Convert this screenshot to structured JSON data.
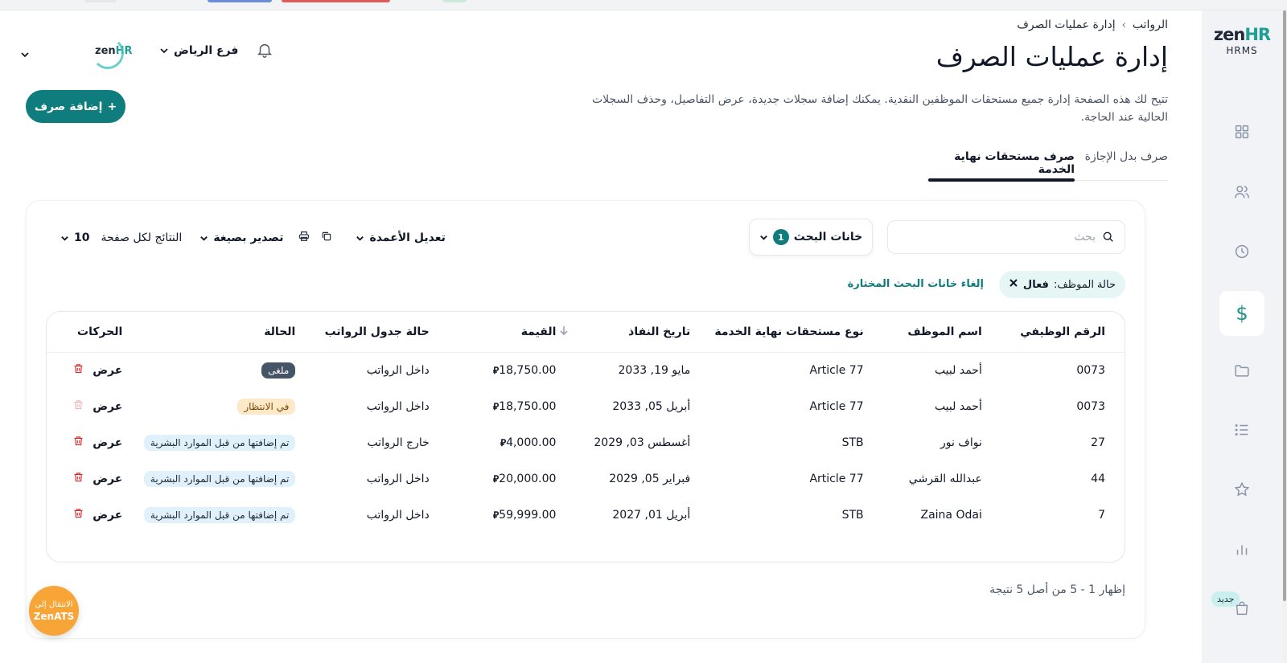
{
  "brand": {
    "logo_zen": "zen",
    "logo_hr": "HR",
    "sub": "HRMS"
  },
  "sidebar": {
    "items": [
      {
        "icon": "dashboard-grid-icon"
      },
      {
        "icon": "users-icon"
      },
      {
        "icon": "clock-icon"
      },
      {
        "icon": "dollar-icon",
        "label": "$",
        "active": true
      },
      {
        "icon": "folder-icon"
      },
      {
        "icon": "list-icon"
      },
      {
        "icon": "star-icon"
      },
      {
        "icon": "bar-chart-icon"
      },
      {
        "icon": "shopping-bag-icon"
      }
    ],
    "new_badge": "جديد"
  },
  "header": {
    "branch": "فرع الرياض",
    "company_logo_zen": "zen",
    "company_logo_hr": "HR"
  },
  "breadcrumb": {
    "parent": "الرواتب",
    "separator": "›",
    "current": "إدارة عمليات الصرف"
  },
  "page": {
    "title": "إدارة عمليات الصرف",
    "description": "تتيح لك هذه الصفحة إدارة جميع مستحقات الموظفين النقدية. يمكنك إضافة سجلات جديدة، عرض التفاصيل، وحذف السجلات الحالية عند الحاجة.",
    "add_button": "إضافة صرف",
    "add_button_icon": "+"
  },
  "tabs": [
    {
      "label": "صرف بدل الإجازة",
      "active": false
    },
    {
      "label": "صرف مستحقات نهاية الخدمة",
      "active": true
    }
  ],
  "search": {
    "placeholder": "بحث",
    "value": ""
  },
  "filter": {
    "label": "خانات البحث",
    "count": "1"
  },
  "toolbar": {
    "columns_label": "تعديل الأعمدة",
    "export_label": "تصدير بصيغة",
    "per_page_label": "النتائج لكل صفحة",
    "per_page_value": "10"
  },
  "active_filter": {
    "key": "حالة الموظف:",
    "value": "فعال"
  },
  "clear_filters": "إلغاء خانات البحث المختارة",
  "table": {
    "headers": {
      "id": "الرقم الوظيفي",
      "name": "اسم الموظف",
      "type": "نوع مستحقات نهاية الخدمة",
      "date": "تاريخ النفاذ",
      "amount": "القيمة",
      "payroll": "حالة جدول الرواتب",
      "status": "الحالة",
      "actions": "الحركات"
    },
    "currency_symbol": "⃁",
    "view_label": "عرض",
    "rows": [
      {
        "id": "0073",
        "name": "أحمد لبيب",
        "type": "Article 77",
        "date": "مايو 19, 2033",
        "amount": "18,750.00",
        "payroll": "داخل الرواتب",
        "status": "ملغى",
        "status_kind": "closed",
        "delete_enabled": true
      },
      {
        "id": "0073",
        "name": "أحمد لبيب",
        "type": "Article 77",
        "date": "أبريل 05, 2033",
        "amount": "18,750.00",
        "payroll": "داخل الرواتب",
        "status": "في الانتظار",
        "status_kind": "pending",
        "delete_enabled": false
      },
      {
        "id": "27",
        "name": "نواف نور",
        "type": "STB",
        "date": "أغسطس 03, 2029",
        "amount": "4,000.00",
        "payroll": "خارج الرواتب",
        "status": "تم إضافتها من قبل الموارد البشرية",
        "status_kind": "added",
        "delete_enabled": true
      },
      {
        "id": "44",
        "name": "عبدالله القرشي",
        "type": "Article 77",
        "date": "فبراير 05, 2029",
        "amount": "20,000.00",
        "payroll": "داخل الرواتب",
        "status": "تم إضافتها من قبل الموارد البشرية",
        "status_kind": "added",
        "delete_enabled": true
      },
      {
        "id": "7",
        "name": "Zaina Odai",
        "type": "STB",
        "date": "أبريل 01, 2027",
        "amount": "59,999.00",
        "payroll": "داخل الرواتب",
        "status": "تم إضافتها من قبل الموارد البشرية",
        "status_kind": "added",
        "delete_enabled": true
      }
    ]
  },
  "results_summary": "إظهار 1 - 5 من أصل 5 نتيجة",
  "ats_button": {
    "line1": "الانتقال إلى",
    "line2": "ZenATS"
  },
  "colors": {
    "primary": "#0f7c7d",
    "brand_teal": "#1f9e96",
    "ats_orange": "#f7a536",
    "danger": "#dc2626"
  }
}
